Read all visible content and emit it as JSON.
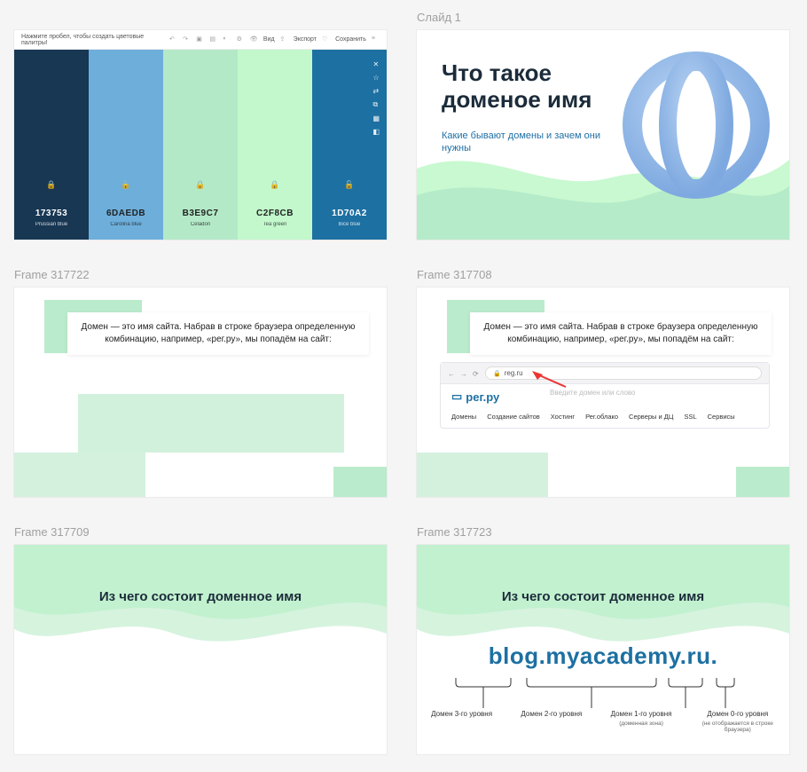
{
  "frames": {
    "f0": "",
    "f1": "Слайд 1",
    "f2": "Frame 317722",
    "f3": "Frame 317708",
    "f4": "Frame 317709",
    "f5": "Frame 317723"
  },
  "palette": {
    "hint": "Нажмите пробел, чтобы создать цветовые палитры!",
    "toolbar": {
      "view": "Вид",
      "export": "Экспорт",
      "save": "Сохранить"
    },
    "colors": [
      {
        "hex": "173753",
        "name": "Prussian blue",
        "bg": "#173753",
        "dark": false
      },
      {
        "hex": "6DAEDB",
        "name": "Carolina blue",
        "bg": "#6daedb",
        "dark": true
      },
      {
        "hex": "B3E9C7",
        "name": "Celadon",
        "bg": "#b3e9c7",
        "dark": true
      },
      {
        "hex": "C2F8CB",
        "name": "Tea green",
        "bg": "#c2f8cb",
        "dark": true
      },
      {
        "hex": "1D70A2",
        "name": "Bice blue",
        "bg": "#1d70a2",
        "dark": false
      }
    ]
  },
  "slide1": {
    "title_l1": "Что такое",
    "title_l2": "доменое имя",
    "subtitle": "Какие бывают домены и зачем они нужны"
  },
  "definition": {
    "text": "Домен — это имя сайта. Набрав в строке браузера определенную комбинацию, например, «рег.ру», мы попадём на сайт:"
  },
  "browser": {
    "url": "reg.ru",
    "logo": "рег.ру",
    "search_placeholder": "Введите домен или слово",
    "nav": [
      "Домены",
      "Создание сайтов",
      "Хостинг",
      "Рег.облако",
      "Серверы и ДЦ",
      "SSL",
      "Сервисы"
    ]
  },
  "structure": {
    "heading": "Из чего состоит доменное имя",
    "url": "blog.myacademy.ru.",
    "parts": [
      {
        "label": "Домен 3-го уровня",
        "sub": ""
      },
      {
        "label": "Домен 2-го уровня",
        "sub": ""
      },
      {
        "label": "Домен 1-го уровня",
        "sub": "(доменная зона)"
      },
      {
        "label": "Домен 0-го уровня",
        "sub": "(не отображается в строке браузера)"
      }
    ]
  }
}
